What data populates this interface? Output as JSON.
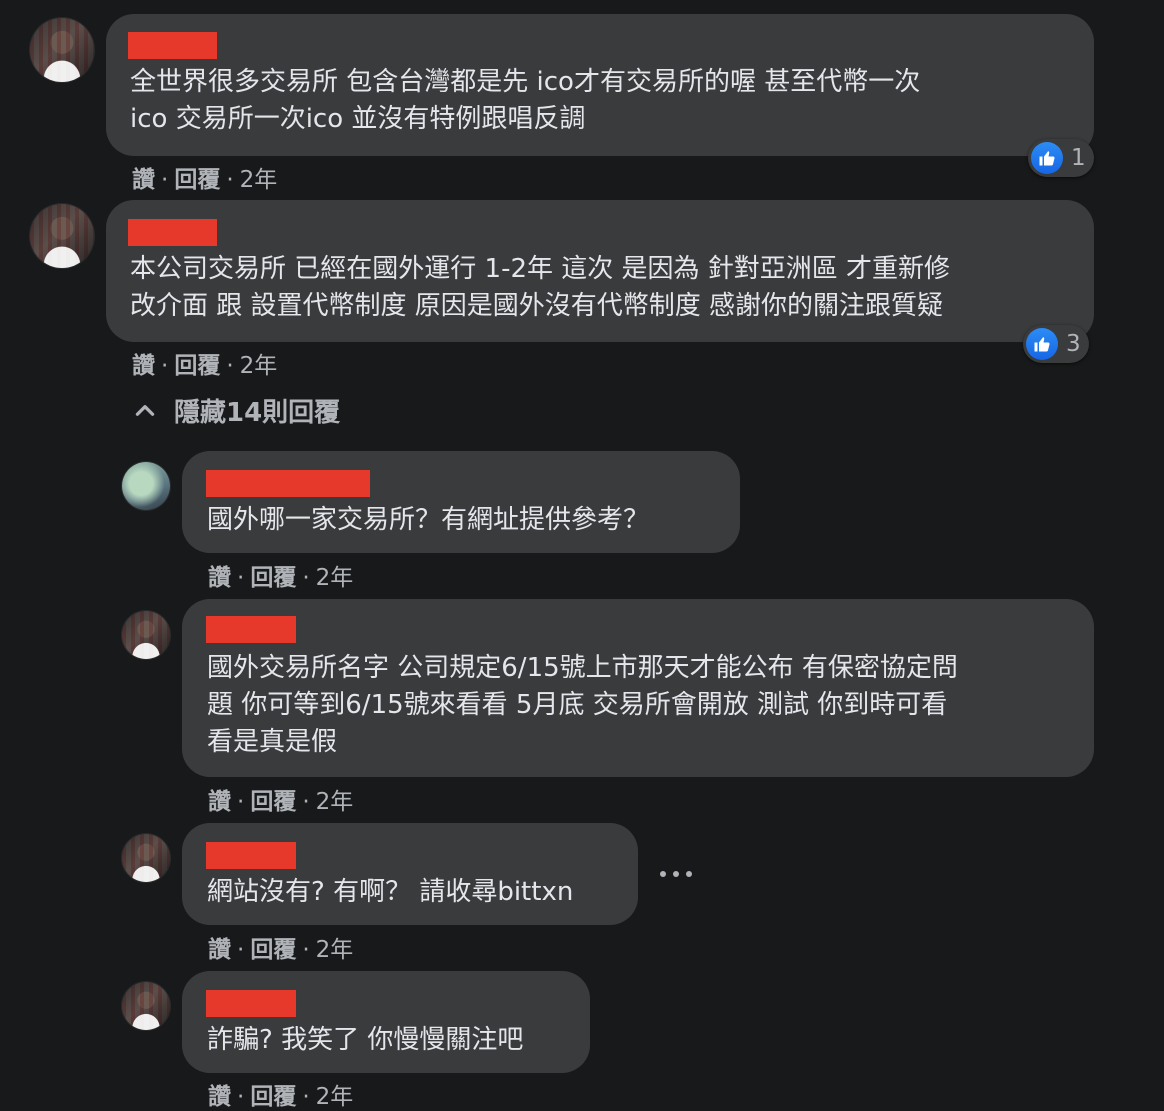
{
  "comments": [
    {
      "text": "全世界很多交易所 包含台灣都是先 ico才有交易所的喔 甚至代幣一次\nico 交易所一次ico 並沒有特例跟唱反調",
      "like": "讚",
      "reply": "回覆",
      "time": "2年",
      "reactions": "1"
    },
    {
      "text": "本公司交易所 已經在國外運行 1-2年 這次 是因為 針對亞洲區 才重新修\n改介面 跟 設置代幣制度 原因是國外沒有代幣制度 感謝你的關注跟質疑",
      "like": "讚",
      "reply": "回覆",
      "time": "2年",
      "reactions": "3"
    }
  ],
  "replies_toggle": "隱藏14則回覆",
  "replies": [
    {
      "text": "國外哪一家交易所？有網址提供參考？",
      "like": "讚",
      "reply": "回覆",
      "time": "2年"
    },
    {
      "text": "國外交易所名字 公司規定6/15號上市那天才能公布 有保密協定問\n題 你可等到6/15號來看看 5月底 交易所會開放 測試 你到時可看\n看是真是假",
      "like": "讚",
      "reply": "回覆",
      "time": "2年"
    },
    {
      "text": "網站沒有? 有啊？ 請收尋bittxn",
      "like": "讚",
      "reply": "回覆",
      "time": "2年"
    },
    {
      "text": "詐騙? 我笑了 你慢慢關注吧",
      "like": "讚",
      "reply": "回覆",
      "time": "2年"
    }
  ],
  "colors": {
    "background": "#18191a",
    "bubble": "#3a3b3c",
    "redaction": "#e6392b",
    "like_blue": "#1877f2"
  }
}
